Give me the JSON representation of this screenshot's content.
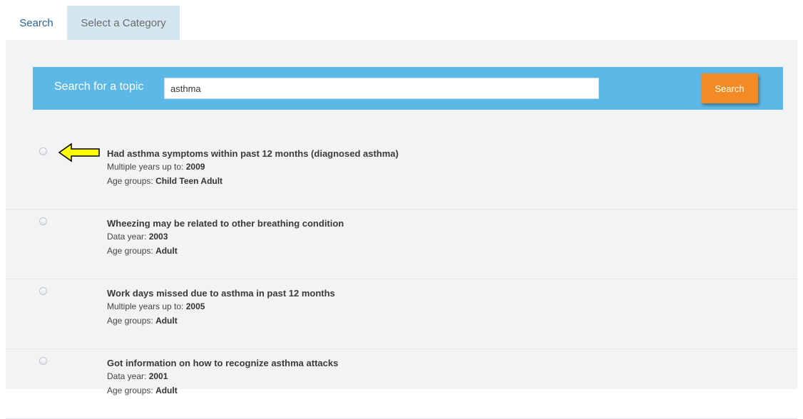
{
  "tabs": [
    {
      "label": "Search",
      "active": true
    },
    {
      "label": "Select a Category",
      "active": false
    }
  ],
  "search": {
    "label": "Search for a topic",
    "value": "asthma",
    "button_label": "Search"
  },
  "colors": {
    "search_bar": "#5db8e6",
    "search_button": "#f28a25",
    "arrow": "#ffff00"
  },
  "results": [
    {
      "title": "Had asthma symptoms within past 12 months (diagnosed asthma)",
      "year_label": "Multiple years up to:",
      "year_value": "2009",
      "age_label": "Age groups:",
      "age_value": "Child Teen Adult",
      "annotated": true
    },
    {
      "title": "Wheezing may be related to other breathing condition",
      "year_label": "Data year:",
      "year_value": "2003",
      "age_label": "Age groups:",
      "age_value": "Adult"
    },
    {
      "title": "Work days missed due to asthma in past 12 months",
      "year_label": "Multiple years up to:",
      "year_value": "2005",
      "age_label": "Age groups:",
      "age_value": "Adult"
    },
    {
      "title": "Got information on how to recognize asthma attacks",
      "year_label": "Data year:",
      "year_value": "2001",
      "age_label": "Age groups:",
      "age_value": "Adult"
    }
  ]
}
